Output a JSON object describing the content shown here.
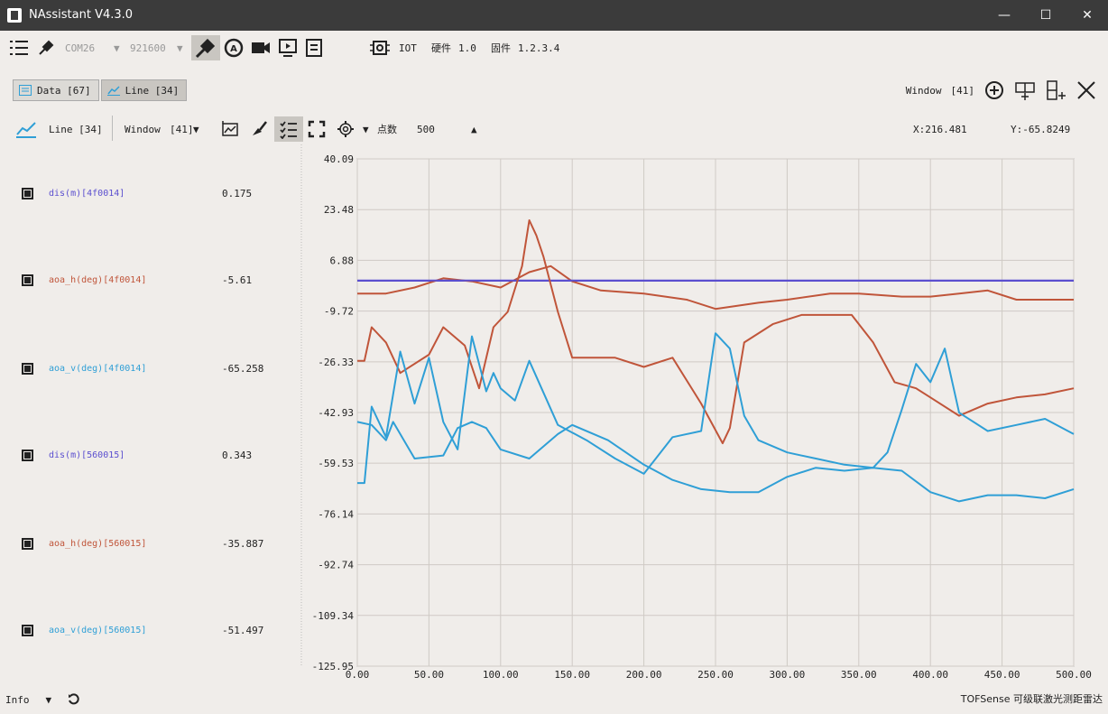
{
  "window": {
    "title": "NAssistant V4.3.0",
    "minimize": "—",
    "maximize": "☐",
    "close": "✕"
  },
  "toolbar": {
    "port": "COM26",
    "baud": "921600",
    "device_type": "IOT",
    "hardware_label": "硬件",
    "hardware_version": "1.0",
    "firmware_label": "固件",
    "firmware_version": "1.2.3.4"
  },
  "tabs": [
    {
      "label": "Data [67]",
      "icon": "data-table-icon"
    },
    {
      "label": "Line [34]",
      "icon": "line-chart-icon"
    }
  ],
  "window_select": {
    "label": "Window",
    "value": "[41]"
  },
  "subbar": {
    "chart_label": "Line [34]",
    "window_label": "Window",
    "window_value": "[41]",
    "points_label": "点数",
    "points_value": "500",
    "x_readout": "X:216.481",
    "y_readout": "Y:-65.8249"
  },
  "legend": [
    {
      "name": "dis(m)[4f0014]",
      "value": "0.175",
      "color": "#5b4fcf"
    },
    {
      "name": "aoa_h(deg)[4f0014]",
      "value": "-5.61",
      "color": "#c0553a"
    },
    {
      "name": "aoa_v(deg)[4f0014]",
      "value": "-65.258",
      "color": "#2f9fd6"
    },
    {
      "name": "dis(m)[560015]",
      "value": "0.343",
      "color": "#5b4fcf"
    },
    {
      "name": "aoa_h(deg)[560015]",
      "value": "-35.887",
      "color": "#c0553a"
    },
    {
      "name": "aoa_v(deg)[560015]",
      "value": "-51.497",
      "color": "#2f9fd6"
    }
  ],
  "status": {
    "left": "Info",
    "right": "TOFSense 可级联激光测距雷达"
  },
  "chart_data": {
    "type": "line",
    "xlim": [
      0,
      500
    ],
    "ylim": [
      -125.95,
      40.09
    ],
    "x_ticks": [
      "0.00",
      "50.00",
      "100.00",
      "150.00",
      "200.00",
      "250.00",
      "300.00",
      "350.00",
      "400.00",
      "450.00",
      "500.00"
    ],
    "y_ticks": [
      "40.09",
      "23.48",
      "6.88",
      "-9.72",
      "-26.33",
      "-42.93",
      "-59.53",
      "-76.14",
      "-92.74",
      "-109.34",
      "-125.95"
    ],
    "grid": true,
    "series": [
      {
        "name": "dis(m)[4f0014]",
        "color": "#5b4fcf",
        "x": [
          0,
          50,
          100,
          150,
          200,
          250,
          300,
          350,
          400,
          450,
          500
        ],
        "values": [
          0.2,
          0.2,
          0.2,
          0.2,
          0.2,
          0.2,
          0.2,
          0.2,
          0.2,
          0.2,
          0.2
        ]
      },
      {
        "name": "aoa_h(deg)[4f0014]",
        "color": "#c0553a",
        "x": [
          0,
          20,
          40,
          60,
          80,
          100,
          120,
          135,
          150,
          170,
          200,
          230,
          250,
          280,
          300,
          330,
          350,
          380,
          400,
          420,
          440,
          460,
          480,
          500
        ],
        "values": [
          -4,
          -4,
          -2,
          1,
          0,
          -2,
          3,
          5,
          0,
          -3,
          -4,
          -6,
          -9,
          -7,
          -6,
          -4,
          -4,
          -5,
          -5,
          -4,
          -3,
          -6,
          -6,
          -6
        ]
      },
      {
        "name": "aoa_v(deg)[4f0014]",
        "color": "#2f9fd6",
        "x": [
          0,
          10,
          20,
          25,
          40,
          60,
          70,
          80,
          90,
          100,
          120,
          140,
          150,
          175,
          200,
          220,
          240,
          260,
          280,
          300,
          320,
          340,
          360,
          380,
          400,
          420,
          440,
          460,
          480,
          500
        ],
        "values": [
          -46,
          -47,
          -52,
          -46,
          -58,
          -57,
          -48,
          -46,
          -48,
          -55,
          -58,
          -50,
          -47,
          -52,
          -60,
          -65,
          -68,
          -69,
          -69,
          -64,
          -61,
          -62,
          -61,
          -62,
          -69,
          -72,
          -70,
          -70,
          -71,
          -68
        ]
      },
      {
        "name": "dis(m)[560015]",
        "color": "#5b4fcf",
        "x": [
          0,
          50,
          100,
          150,
          200,
          250,
          300,
          350,
          400,
          450,
          500
        ],
        "values": [
          0.3,
          0.3,
          0.3,
          0.3,
          0.3,
          0.3,
          0.3,
          0.3,
          0.3,
          0.3,
          0.3
        ]
      },
      {
        "name": "aoa_h(deg)[560015]",
        "color": "#c0553a",
        "x": [
          0,
          5,
          10,
          20,
          30,
          50,
          60,
          75,
          85,
          95,
          105,
          115,
          120,
          125,
          130,
          140,
          150,
          160,
          180,
          200,
          220,
          240,
          255,
          260,
          270,
          290,
          310,
          330,
          345,
          360,
          375,
          390,
          400,
          420,
          440,
          460,
          480,
          500
        ],
        "values": [
          -26,
          -26,
          -15,
          -20,
          -30,
          -24,
          -15,
          -21,
          -35,
          -15,
          -10,
          5,
          20,
          15,
          8,
          -10,
          -25,
          -25,
          -25,
          -28,
          -25,
          -40,
          -53,
          -48,
          -20,
          -14,
          -11,
          -11,
          -11,
          -20,
          -33,
          -35,
          -38,
          -44,
          -40,
          -38,
          -37,
          -35
        ]
      },
      {
        "name": "aoa_v(deg)[560015]",
        "color": "#2f9fd6",
        "x": [
          0,
          5,
          10,
          20,
          30,
          40,
          50,
          60,
          70,
          80,
          90,
          95,
          100,
          110,
          120,
          140,
          160,
          180,
          200,
          220,
          240,
          250,
          260,
          270,
          280,
          300,
          320,
          340,
          360,
          370,
          380,
          390,
          400,
          410,
          420,
          440,
          460,
          480,
          500
        ],
        "values": [
          -66,
          -66,
          -41,
          -51,
          -23,
          -40,
          -25,
          -46,
          -55,
          -18,
          -36,
          -30,
          -35,
          -39,
          -26,
          -47,
          -52,
          -58,
          -63,
          -51,
          -49,
          -17,
          -22,
          -44,
          -52,
          -56,
          -58,
          -60,
          -61,
          -56,
          -42,
          -27,
          -33,
          -22,
          -43,
          -49,
          -47,
          -45,
          -50
        ]
      }
    ]
  }
}
